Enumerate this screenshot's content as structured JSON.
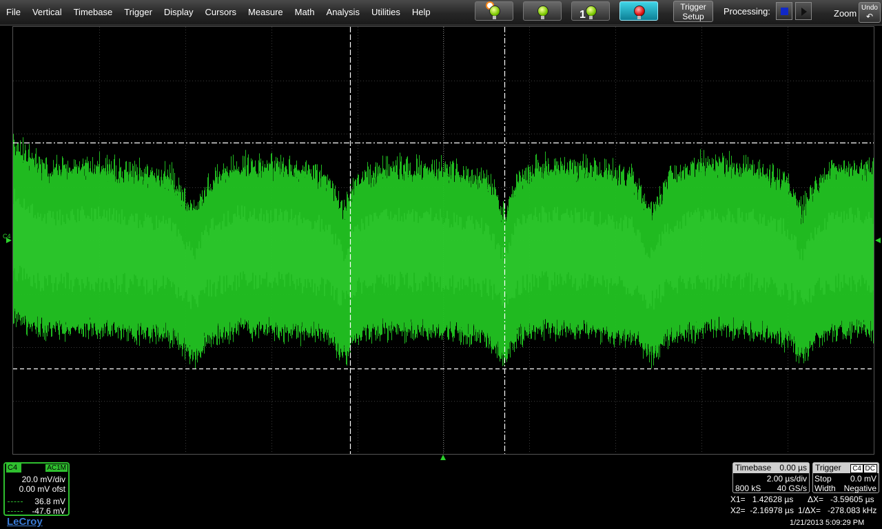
{
  "menu": [
    "File",
    "Vertical",
    "Timebase",
    "Trigger",
    "Display",
    "Cursors",
    "Measure",
    "Math",
    "Analysis",
    "Utilities",
    "Help"
  ],
  "toolbar": {
    "trigger_mode_1": "1",
    "trigger_setup_line1": "Trigger",
    "trigger_setup_line2": "Setup",
    "processing_label": "Processing:",
    "zoom_label": "Zoom",
    "undo_label": "Undo"
  },
  "colors": {
    "trace": "#22c422",
    "channel_accent": "#2fc02f",
    "active_button": "#1aa9c0"
  },
  "display": {
    "channel_marker": "C4"
  },
  "channel": {
    "label": "C4",
    "coupling": "AC1M",
    "scale": "20.0 mV/div",
    "offset": "0.00 mV ofst",
    "cursor1": "36.8 mV",
    "cursor2": "-47.6 mV"
  },
  "brand": "LeCroy",
  "timebase": {
    "title": "Timebase",
    "delay": "0.00 µs",
    "scale": "2.00 µs/div",
    "samples": "800 kS",
    "rate": "40 GS/s"
  },
  "trigger": {
    "title": "Trigger",
    "source": "C4",
    "coupling": "DC",
    "mode": "Stop",
    "level": "0.0 mV",
    "type": "Width",
    "polarity": "Negative"
  },
  "cursors": {
    "x1": "X1=   1.42628 µs",
    "dx": "ΔX=   -3.59605 µs",
    "x2": "X2=  -2.16978 µs",
    "inv_dx": "1/ΔX=   -278.083 kHz"
  },
  "timestamp": "1/21/2013 5:09:29 PM"
}
